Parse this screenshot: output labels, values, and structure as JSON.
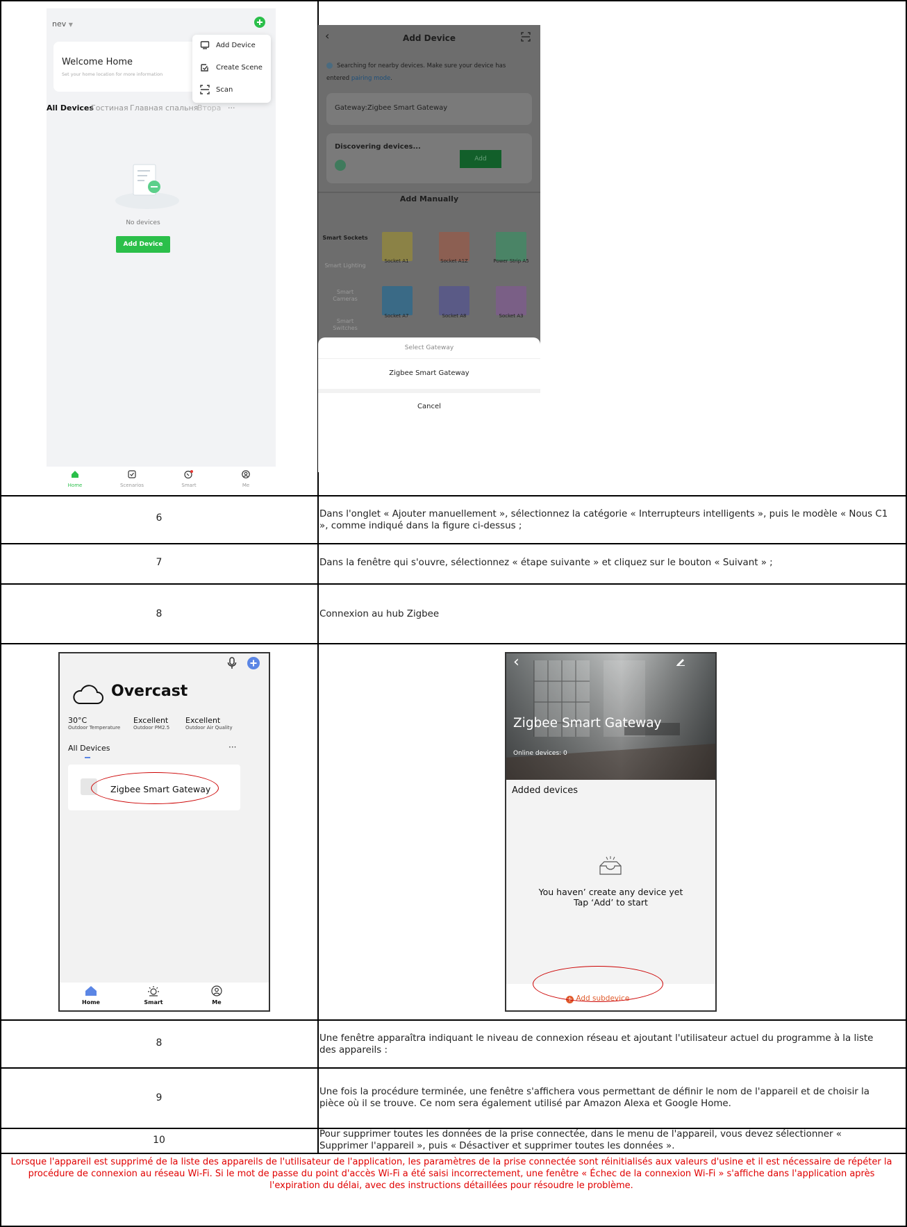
{
  "phone1": {
    "home_selector": "nev",
    "welcome_title": "Welcome Home",
    "welcome_sub": "Set your home location for more information",
    "menu": [
      {
        "label": "Add Device"
      },
      {
        "label": "Create Scene"
      },
      {
        "label": "Scan"
      }
    ],
    "room_tabs": [
      "All Devices",
      "Гостиная",
      "Главная спальня",
      "Втора"
    ],
    "more": "···",
    "empty_text": "No devices",
    "add_button": "Add Device",
    "tabs": [
      "Home",
      "Scenarios",
      "Smart",
      "Me"
    ]
  },
  "phone2": {
    "title": "Add Device",
    "search_text": "Searching for nearby devices. Make sure your device has entered",
    "search_link": "pairing mode",
    "search_end": ".",
    "gateway_card": "Gateway:Zigbee Smart Gateway",
    "discovering": "Discovering devices...",
    "add_btn": "Add",
    "add_manually": "Add Manually",
    "categories": [
      "Smart Sockets",
      "Smart Lighting",
      "Smart Cameras",
      "Smart Switches"
    ],
    "devices": [
      "Socket A1",
      "Socket A1Z",
      "Power Strip A5",
      "Socket A7",
      "Socket A8",
      "Socket A3"
    ],
    "sheet_title": "Select Gateway",
    "sheet_option": "Zigbee Smart Gateway",
    "sheet_cancel": "Cancel"
  },
  "rows": [
    {
      "num": "6",
      "text": "Dans l'onglet « Ajouter manuellement », sélectionnez la catégorie « Interrupteurs intelligents », puis le modèle « Nous C1 », comme indiqué dans la figure ci-dessus ;"
    },
    {
      "num": "7",
      "text": "Dans la fenêtre qui s'ouvre, sélectionnez « étape suivante » et cliquez sur le bouton « Suivant » ;"
    },
    {
      "num": "8",
      "text": "Connexion au hub Zigbee"
    }
  ],
  "phone3": {
    "weather": "Overcast",
    "stats": [
      {
        "value": "30°C",
        "label": "Outdoor Temperature"
      },
      {
        "value": "Excellent",
        "label": "Outdoor PM2.5"
      },
      {
        "value": "Excellent",
        "label": "Outdoor Air Quality"
      }
    ],
    "all_devices": "All Devices",
    "more": "···",
    "device": "Zigbee Smart Gateway",
    "tabs": [
      "Home",
      "Smart",
      "Me"
    ]
  },
  "phone4": {
    "title": "Zigbee Smart Gateway",
    "online": "Online devices: 0",
    "added": "Added devices",
    "empty1": "You haven’ create any device yet",
    "empty2": "Tap ‘Add’ to start",
    "add_sub": "Add subdevice"
  },
  "rows2": [
    {
      "num": "8",
      "text": "Une fenêtre apparaîtra indiquant le niveau de connexion réseau et ajoutant l'utilisateur actuel du programme à la liste des appareils :"
    },
    {
      "num": "9",
      "text": "Une fois la procédure terminée, une fenêtre s'affichera vous permettant de définir le nom de l'appareil et de choisir la pièce où il se trouve. Ce nom sera également utilisé par Amazon Alexa et Google Home."
    },
    {
      "num": "10",
      "text": "Pour supprimer toutes les données de la prise connectée, dans le menu de l'appareil, vous devez sélectionner « Supprimer l'appareil », puis « Désactiver et supprimer toutes les données »."
    }
  ],
  "note": "Lorsque l'appareil est supprimé de la liste des appareils de l'utilisateur de l'application, les paramètres de la prise connectée sont réinitialisés aux valeurs d'usine et il est nécessaire de répéter la procédure de connexion au réseau Wi-Fi. Si le mot de passe du point d'accès Wi-Fi a été saisi incorrectement, une fenêtre « Échec de la connexion Wi-Fi » s'affiche dans l'application après l'expiration du délai, avec des instructions détaillées pour résoudre le problème.",
  "colors": {
    "accent_green": "#2bbf4a",
    "annotation_red": "#cc0000",
    "note_red": "#e00000",
    "blue": "#5b86e5"
  }
}
